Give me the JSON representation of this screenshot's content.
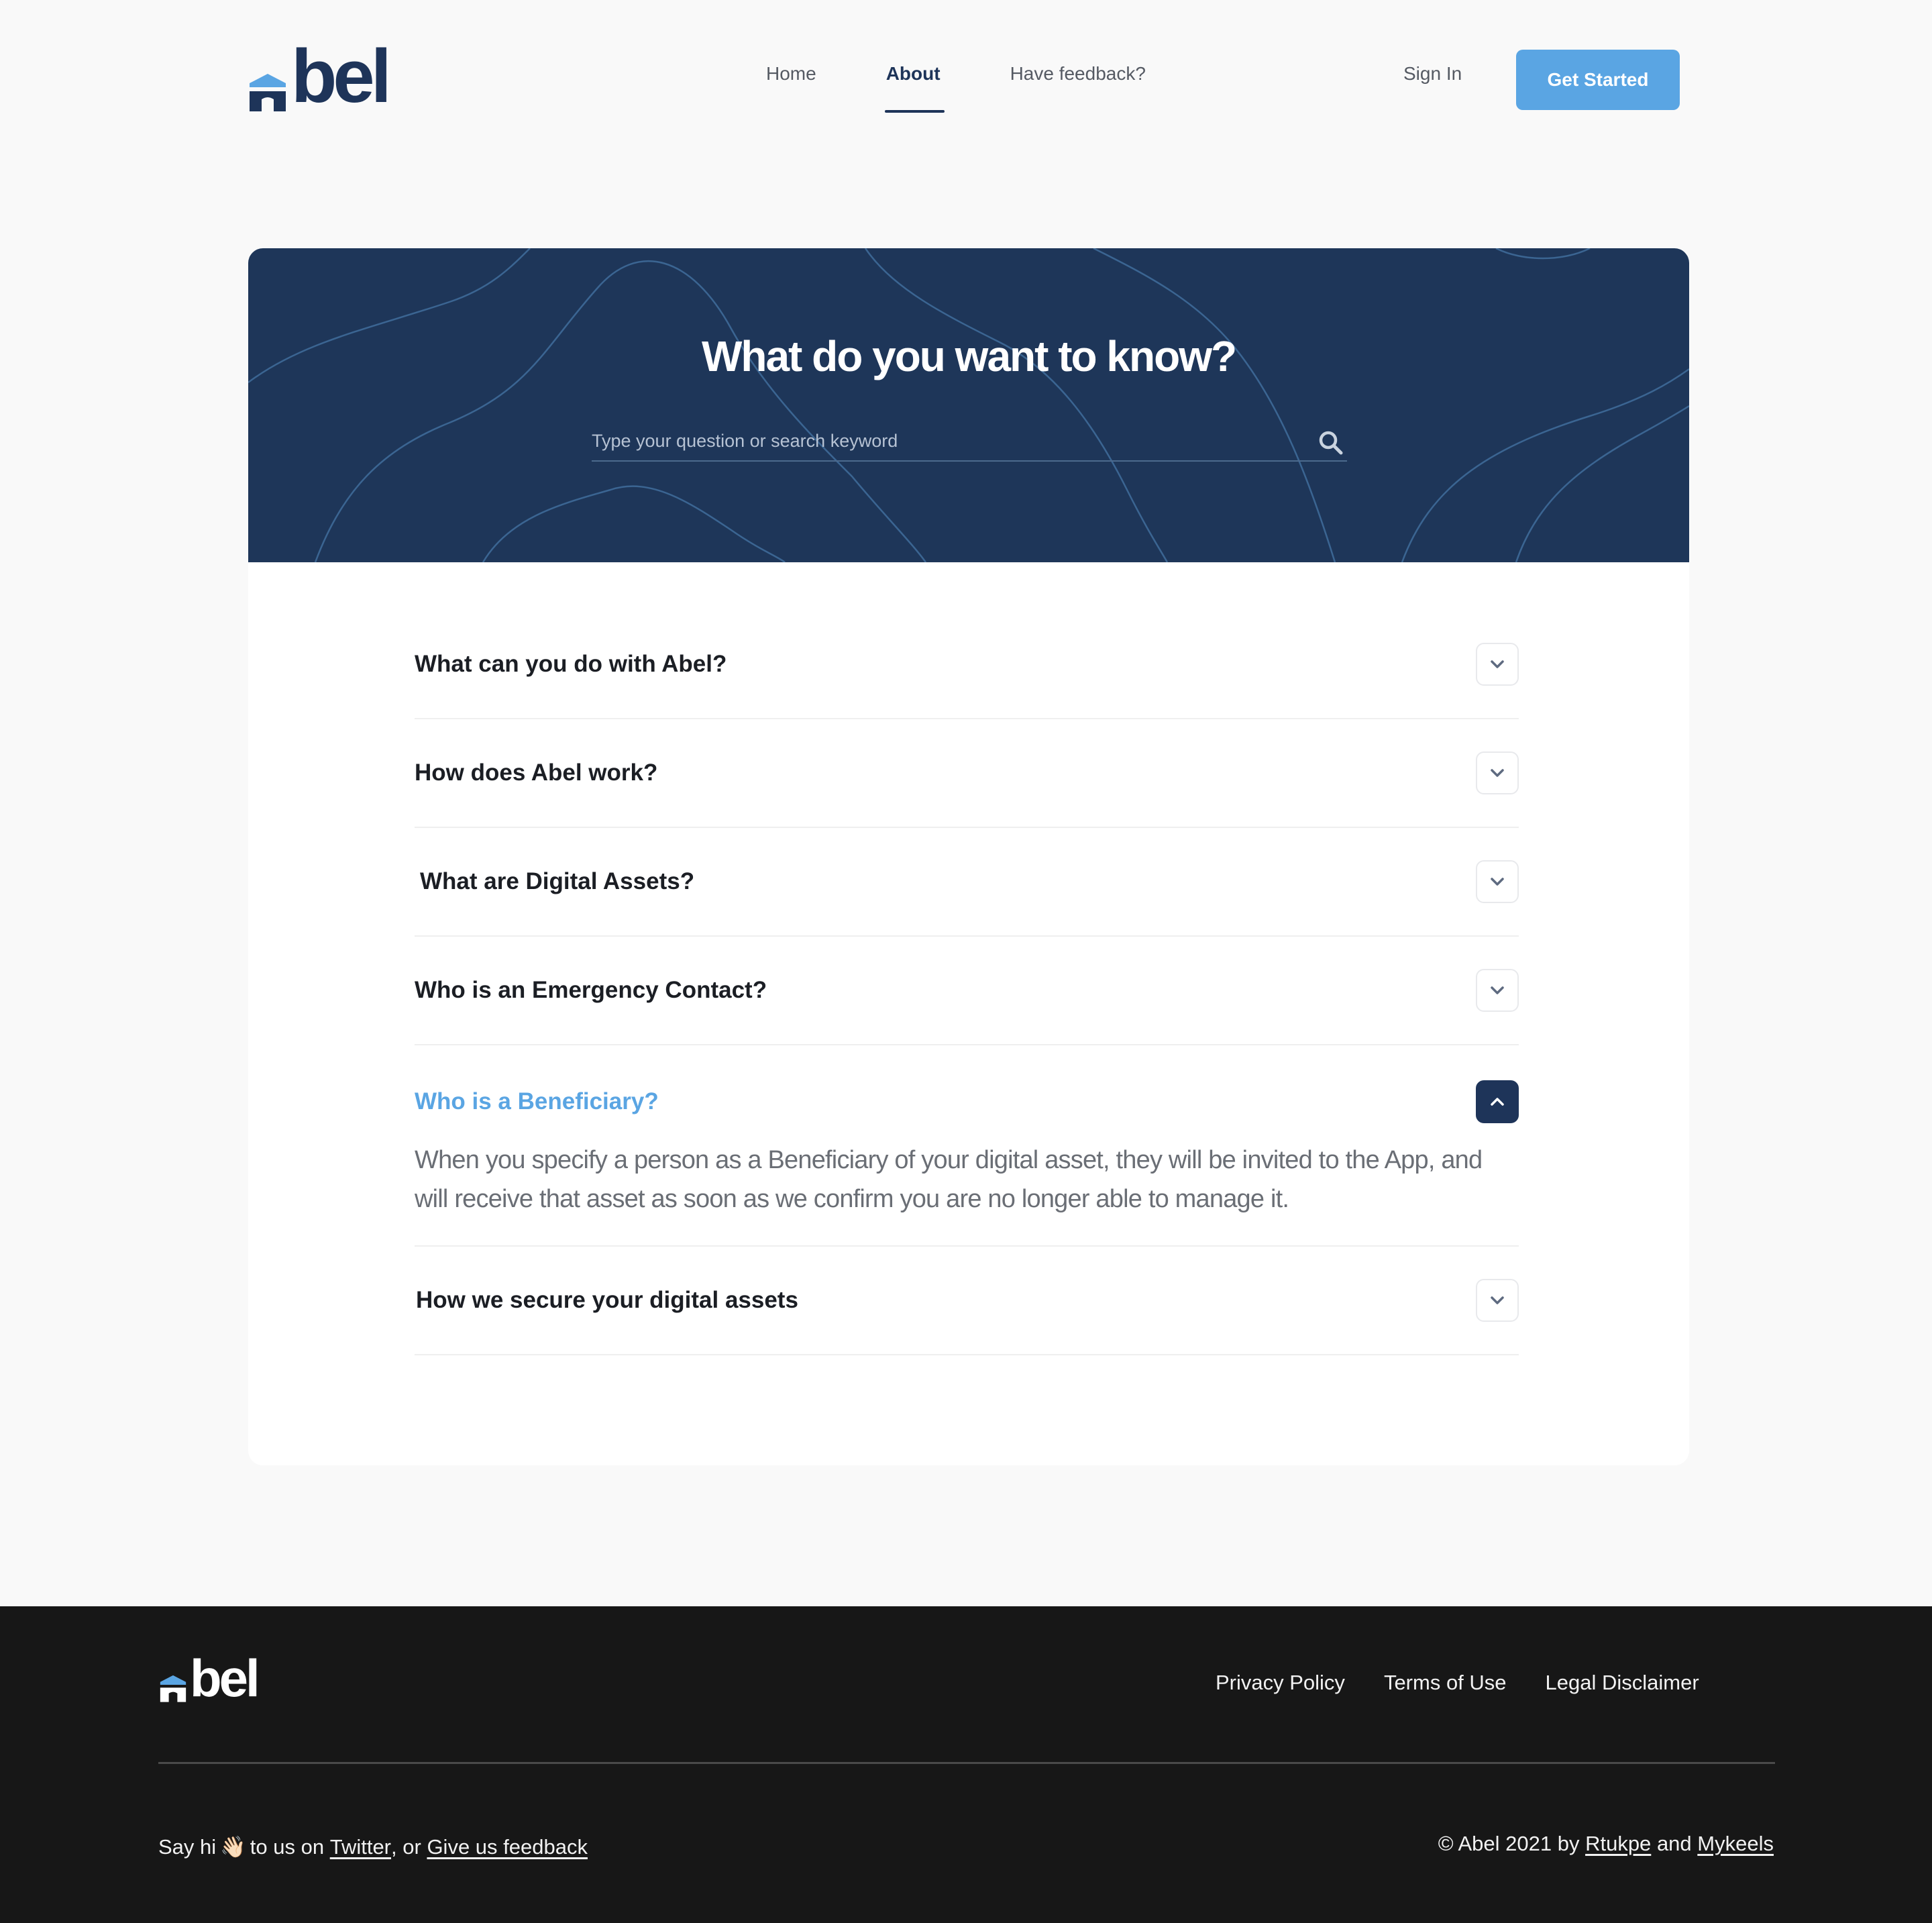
{
  "brand": {
    "name": "bel",
    "primary": "#1e3459",
    "accent": "#5aa5e3"
  },
  "nav": {
    "items": [
      {
        "label": "Home"
      },
      {
        "label": "About"
      },
      {
        "label": "Have feedback?"
      }
    ],
    "active": "About",
    "sign_in": "Sign In",
    "cta": "Get Started"
  },
  "hero": {
    "title": "What do you want to know?",
    "search_placeholder": "Type your question or search keyword",
    "search_icon": "search-icon"
  },
  "faq": {
    "items": [
      {
        "question": "What can you do with Abel?",
        "open": false
      },
      {
        "question": "How does Abel work?",
        "open": false
      },
      {
        "question": "What are Digital Assets?",
        "open": false
      },
      {
        "question": "Who is an Emergency Contact?",
        "open": false
      },
      {
        "question": "Who is a Beneficiary?",
        "open": true,
        "answer": "When you specify a person as a Beneficiary of your digital asset, they will be invited to the App, and will receive that asset as soon as we confirm you are no longer able to manage it."
      },
      {
        "question": "How we secure your digital assets",
        "open": false
      }
    ]
  },
  "footer": {
    "links": [
      "Privacy Policy",
      "Terms of Use",
      "Legal Disclaimer"
    ],
    "say_hi_prefix": "Say hi",
    "say_hi_mid": "to us on",
    "twitter": "Twitter",
    "or": ", or",
    "feedback": "Give us feedback",
    "copyright_prefix": "© Abel 2021 by",
    "author1": "Rtukpe",
    "and": "and",
    "author2": "Mykeels",
    "emoji": "👋🏻"
  }
}
